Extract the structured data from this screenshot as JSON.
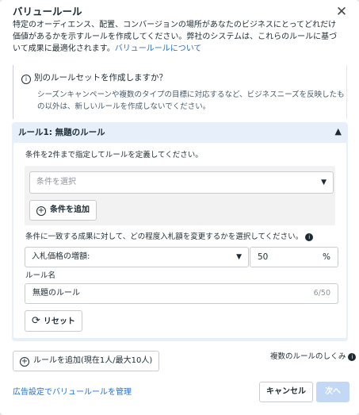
{
  "header": {
    "title": "バリュールール",
    "description": "特定のオーディエンス、配置、コンバージョンの場所があなたのビジネスにとってどれだけ価値があるかを示すルールを作成してください。弊社のシステムは、これらのルールに基づいて成果に最適化されます。",
    "link_label": "バリュールールについて",
    "close_icon": "close-icon"
  },
  "info": {
    "question": "別のルールセットを作成しますか？",
    "body": "シーズンキャンペーンや複数のタイプの目標に対応するなど、ビジネスニーズを反映したもの以外は、新しいルールを作成しないでください。",
    "icon": "question-icon"
  },
  "rule": {
    "heading": "ルール1: 無題のルール",
    "condition_label": "条件を2件まで指定してルールを定義してください。",
    "condition_placeholder": "条件を選択",
    "add_condition_label": "条件を追加",
    "bid_label": "条件に一致する成果に対して、どの程度入札額を変更するかを選択してください。",
    "bid_select_value": "入札価格の増額:",
    "bid_percent_value": "50",
    "bid_percent_unit": "%",
    "name_label": "ルール名",
    "name_value": "無題のルール",
    "name_count": "6/50",
    "reset_label": "リセット"
  },
  "footer": {
    "add_rule_label": "ルールを追加(現在1人/最大10人)",
    "multiple_rules_label": "複数のルールのしくみ",
    "manage_link": "広告設定でバリュールールを管理",
    "cancel_label": "キャンセル",
    "next_label": "次へ"
  },
  "colors": {
    "accent": "#216fdb",
    "panel_bg": "#e7f0fa",
    "next_disabled": "#c3d8f5"
  }
}
